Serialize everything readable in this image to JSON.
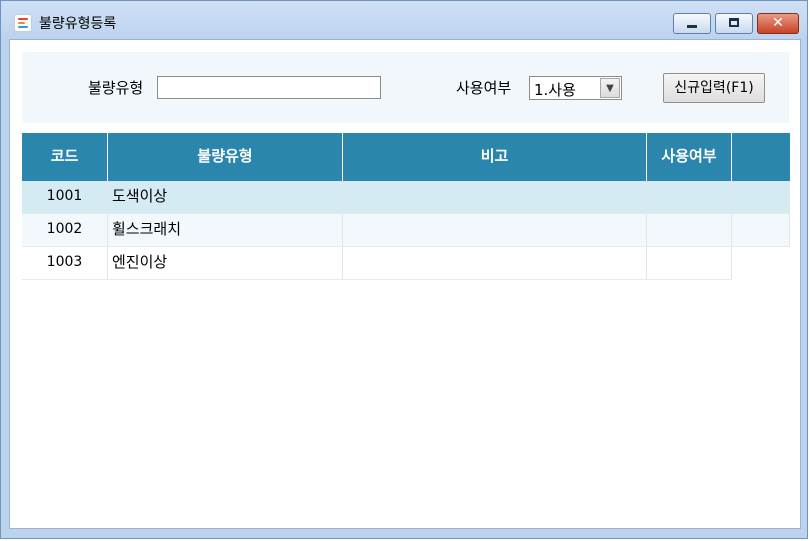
{
  "window": {
    "title": "불량유형등록",
    "icon": "app-logo-icon",
    "controls": [
      "minimize-icon",
      "maximize-icon",
      "close-icon"
    ]
  },
  "search": {
    "type_label": "불량유형",
    "type_value": "",
    "use_label": "사용여부",
    "use_selected": "1.사용",
    "new_button_label": "신규입력(F1)"
  },
  "grid": {
    "columns": [
      "코드",
      "불량유형",
      "비고",
      "사용여부"
    ],
    "rows": [
      {
        "code": "1001",
        "type": "도색이상",
        "note": "",
        "use": ""
      },
      {
        "code": "1002",
        "type": "휠스크래치",
        "note": "",
        "use": ""
      },
      {
        "code": "1003",
        "type": "엔진이상",
        "note": "",
        "use": ""
      }
    ]
  },
  "colors": {
    "header_bg": "#2b86ae",
    "row_selected_bg": "#d5ebf3",
    "row_alt_bg": "#f2f8fb",
    "panel_bg": "#f2f7fb",
    "titlebar_bg": "#c4d8f0"
  }
}
